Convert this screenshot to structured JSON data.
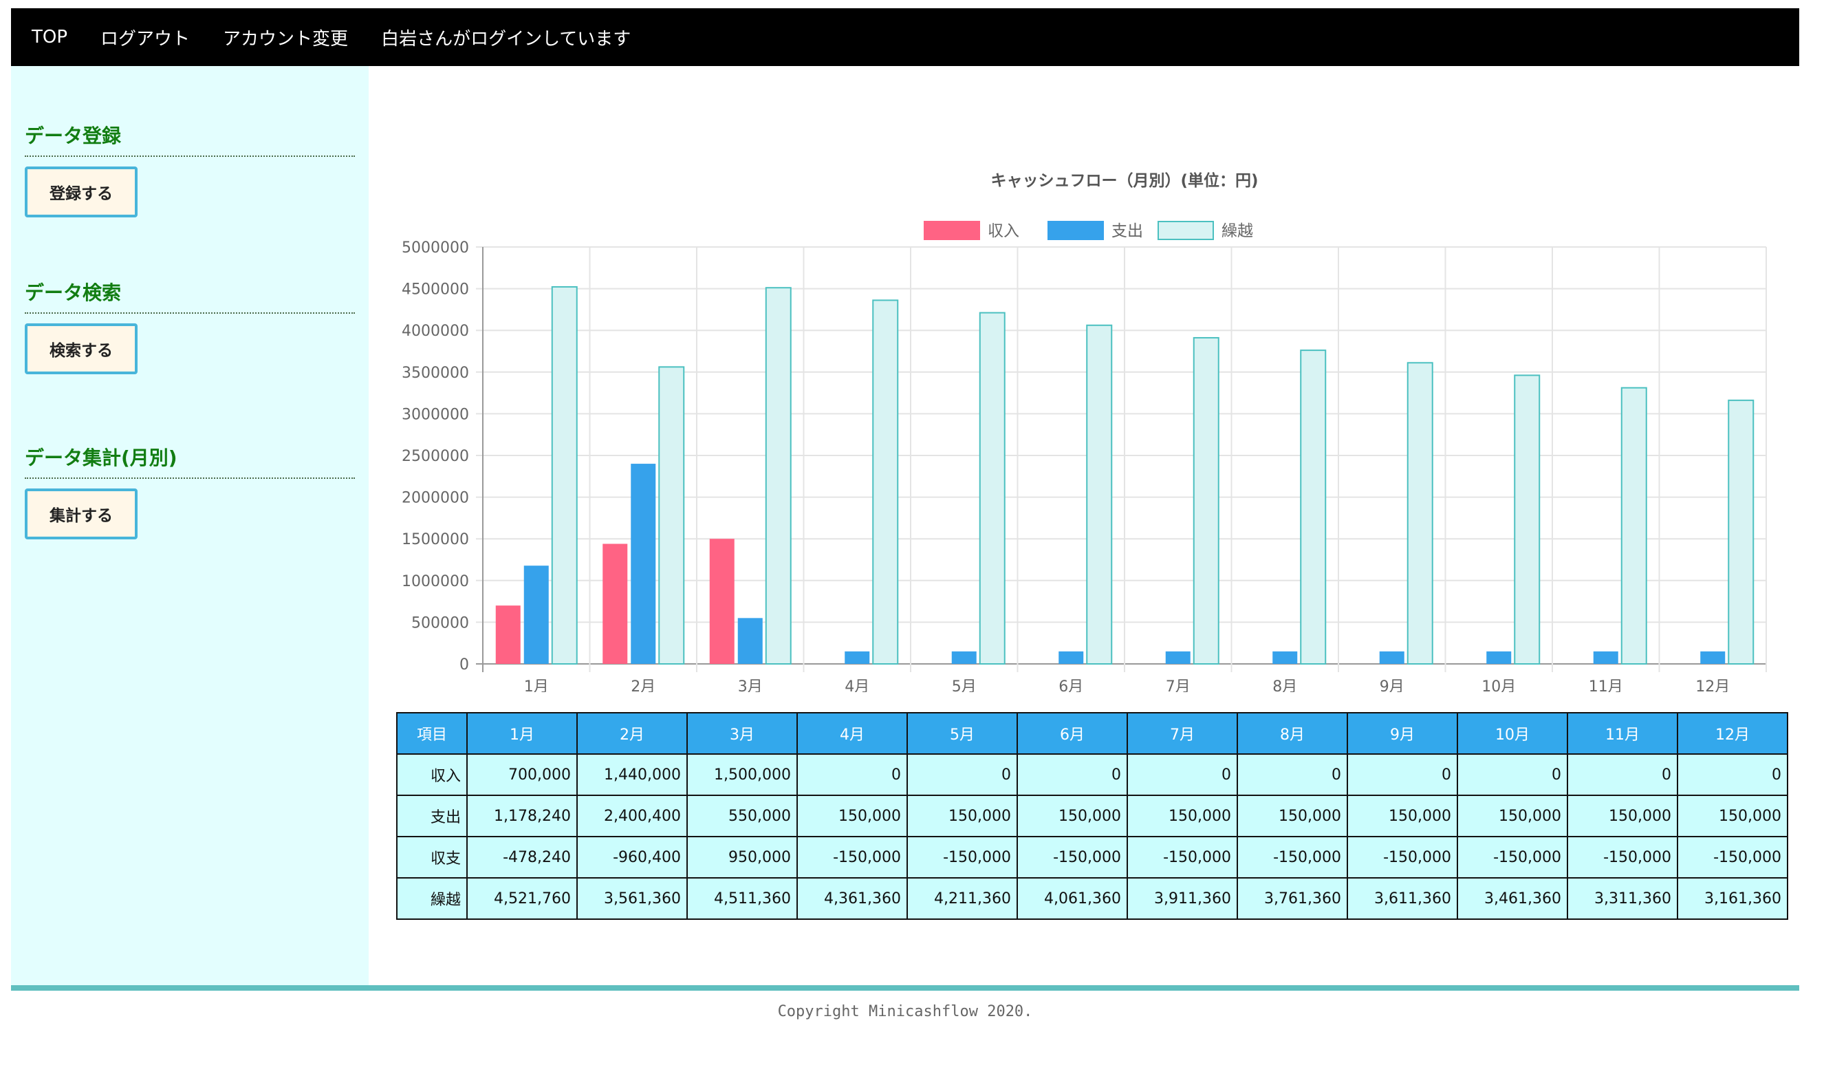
{
  "nav": {
    "top": "TOP",
    "logout": "ログアウト",
    "account": "アカウント変更",
    "status": "白岩さんがログインしています"
  },
  "sidebar": {
    "register_title": "データ登録",
    "register_button": "登録する",
    "search_title": "データ検索",
    "search_button": "検索する",
    "summary_title": "データ集計(月別)",
    "summary_button": "集計する"
  },
  "colors": {
    "income": "#ff6384",
    "expense": "#36a2eb",
    "carry_fill": "#d8f3f3",
    "carry_border": "#4bc0c0"
  },
  "chart_data": {
    "type": "bar",
    "title": "キャッシュフロー（月別）(単位：円)",
    "categories": [
      "1月",
      "2月",
      "3月",
      "4月",
      "5月",
      "6月",
      "7月",
      "8月",
      "9月",
      "10月",
      "11月",
      "12月"
    ],
    "series": [
      {
        "name": "収入",
        "values": [
          700000,
          1440000,
          1500000,
          0,
          0,
          0,
          0,
          0,
          0,
          0,
          0,
          0
        ]
      },
      {
        "name": "支出",
        "values": [
          1178240,
          2400400,
          550000,
          150000,
          150000,
          150000,
          150000,
          150000,
          150000,
          150000,
          150000,
          150000
        ]
      },
      {
        "name": "繰越",
        "values": [
          4521760,
          3561360,
          4511360,
          4361360,
          4211360,
          4061360,
          3911360,
          3761360,
          3611360,
          3461360,
          3311360,
          3161360
        ]
      }
    ],
    "yticks": [
      "0",
      "500000",
      "1000000",
      "1500000",
      "2000000",
      "2500000",
      "3000000",
      "3500000",
      "4000000",
      "4500000",
      "5000000"
    ],
    "ylim": [
      0,
      5000000
    ],
    "grid": true,
    "legend": "top"
  },
  "table": {
    "header_item": "項目",
    "months": [
      "1月",
      "2月",
      "3月",
      "4月",
      "5月",
      "6月",
      "7月",
      "8月",
      "9月",
      "10月",
      "11月",
      "12月"
    ],
    "rows": [
      {
        "label": "収入",
        "values": [
          "700,000",
          "1,440,000",
          "1,500,000",
          "0",
          "0",
          "0",
          "0",
          "0",
          "0",
          "0",
          "0",
          "0"
        ]
      },
      {
        "label": "支出",
        "values": [
          "1,178,240",
          "2,400,400",
          "550,000",
          "150,000",
          "150,000",
          "150,000",
          "150,000",
          "150,000",
          "150,000",
          "150,000",
          "150,000",
          "150,000"
        ]
      },
      {
        "label": "収支",
        "values": [
          "-478,240",
          "-960,400",
          "950,000",
          "-150,000",
          "-150,000",
          "-150,000",
          "-150,000",
          "-150,000",
          "-150,000",
          "-150,000",
          "-150,000",
          "-150,000"
        ]
      },
      {
        "label": "繰越",
        "values": [
          "4,521,760",
          "3,561,360",
          "4,511,360",
          "4,361,360",
          "4,211,360",
          "4,061,360",
          "3,911,360",
          "3,761,360",
          "3,611,360",
          "3,461,360",
          "3,311,360",
          "3,161,360"
        ]
      }
    ]
  },
  "footer": "Copyright Minicashflow 2020."
}
